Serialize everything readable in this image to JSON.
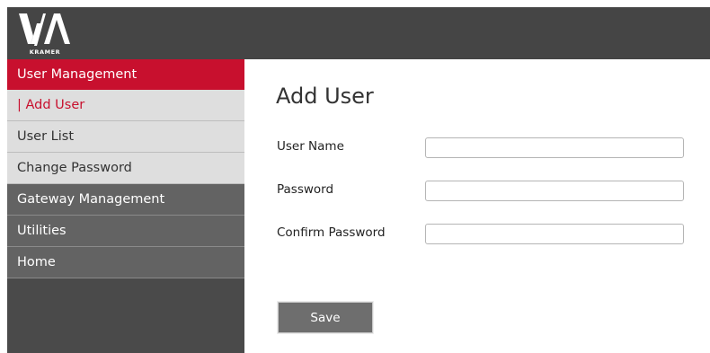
{
  "brand": {
    "logo_text": "V/\\",
    "logo_sub": "KRAMER",
    "colors": {
      "header": "#454545",
      "accent": "#c8102e",
      "sidebar_dark": "#636363",
      "sidebar_light": "#dedede"
    }
  },
  "sidebar": {
    "section_user": "User Management",
    "items": [
      {
        "label": "| Add User",
        "active": true
      },
      {
        "label": "User List",
        "active": false
      },
      {
        "label": "Change Password",
        "active": false
      }
    ],
    "gateway": "Gateway Management",
    "utilities": "Utilities",
    "home": "Home"
  },
  "main": {
    "title": "Add User",
    "fields": [
      {
        "label": "User Name",
        "value": "",
        "placeholder": ""
      },
      {
        "label": "Password",
        "value": "",
        "placeholder": ""
      },
      {
        "label": "Confirm Password",
        "value": "",
        "placeholder": ""
      }
    ],
    "save_label": "Save"
  }
}
